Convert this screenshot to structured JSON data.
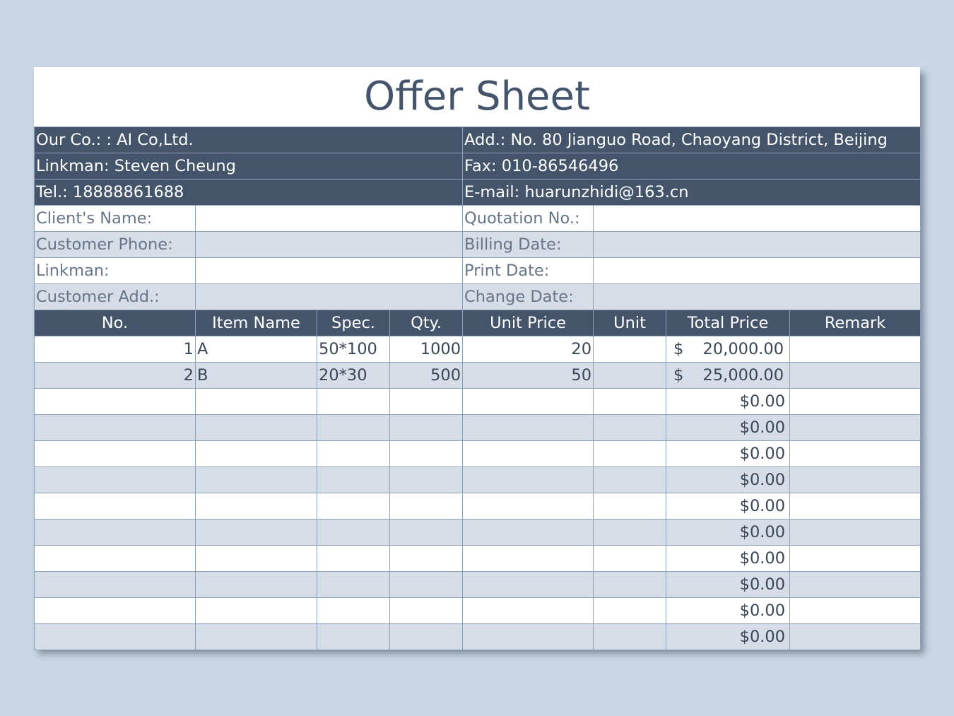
{
  "title": "Offer Sheet",
  "company": {
    "our_co": "Our Co.: :  AI Co,Ltd.",
    "address": "Add.:  No. 80 Jianguo Road, Chaoyang District, Beijing",
    "linkman": "Linkman:  Steven Cheung",
    "fax": "Fax:  010-86546496",
    "tel": "Tel.:  18888861688",
    "email": "E-mail:  huarunzhidi@163.cn"
  },
  "client": {
    "name_label": "Client's Name:",
    "name_value": "",
    "quotation_label": "Quotation No.:",
    "quotation_value": "",
    "phone_label": "Customer Phone:",
    "phone_value": "",
    "billing_label": "Billing Date:",
    "billing_value": "",
    "linkman_label": "Linkman:",
    "linkman_value": "",
    "print_label": "Print Date:",
    "print_value": "",
    "address_label": "Customer Add.:",
    "address_value": "",
    "change_label": "Change Date:",
    "change_value": ""
  },
  "columns": [
    "No.",
    "Item Name",
    "Spec.",
    "Qty.",
    "Unit Price",
    "Unit",
    "Total Price",
    "Remark"
  ],
  "items": [
    {
      "no": "1",
      "name": "A",
      "spec": "50*100",
      "qty": "1000",
      "unit_price": "20",
      "unit": "",
      "currency": "$",
      "total": "20,000.00",
      "remark": ""
    },
    {
      "no": "2",
      "name": "B",
      "spec": "20*30",
      "qty": "500",
      "unit_price": "50",
      "unit": "",
      "currency": "$",
      "total": "25,000.00",
      "remark": ""
    }
  ],
  "empty_totals": [
    "$0.00",
    "$0.00",
    "$0.00",
    "$0.00",
    "$0.00",
    "$0.00",
    "$0.00",
    "$0.00",
    "$0.00",
    "$0.00"
  ],
  "colors": {
    "header": "#44546a",
    "stripe": "#d6dde6",
    "background": "#c8d6e5"
  }
}
